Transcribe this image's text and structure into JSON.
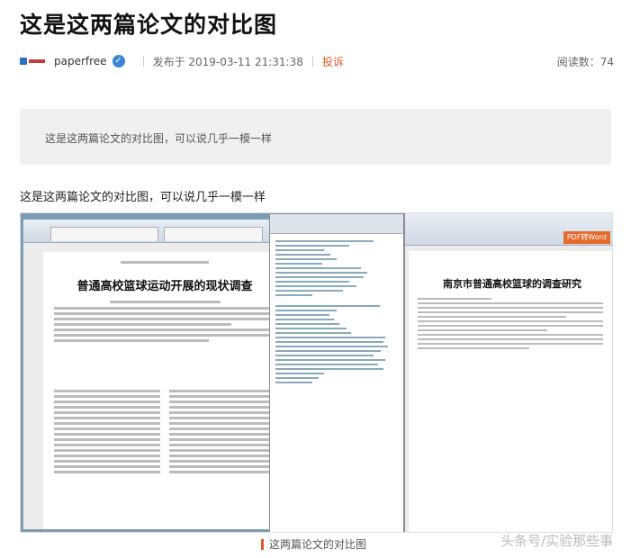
{
  "article": {
    "title": "这是这两篇论文的对比图",
    "author": "paperfree",
    "publish": "发布于 2019-03-11 21:31:38",
    "report": "投诉",
    "reads": "阅读数：74"
  },
  "quote": "这是这两篇论文的对比图，可以说几乎一模一样",
  "paragraph": "这是这两篇论文的对比图，可以说几乎一模一样",
  "figure": {
    "left_headline": "普通高校篮球运动开展的现状调查",
    "right_headline": "南京市普通高校篮球的调查研究",
    "pdf_button": "PDF转Word",
    "caption": "这两篇论文的对比图",
    "credit": "头条号/实验那些事"
  },
  "colors": {
    "accent": "#e05a2b",
    "verified": "#3a86d8"
  }
}
